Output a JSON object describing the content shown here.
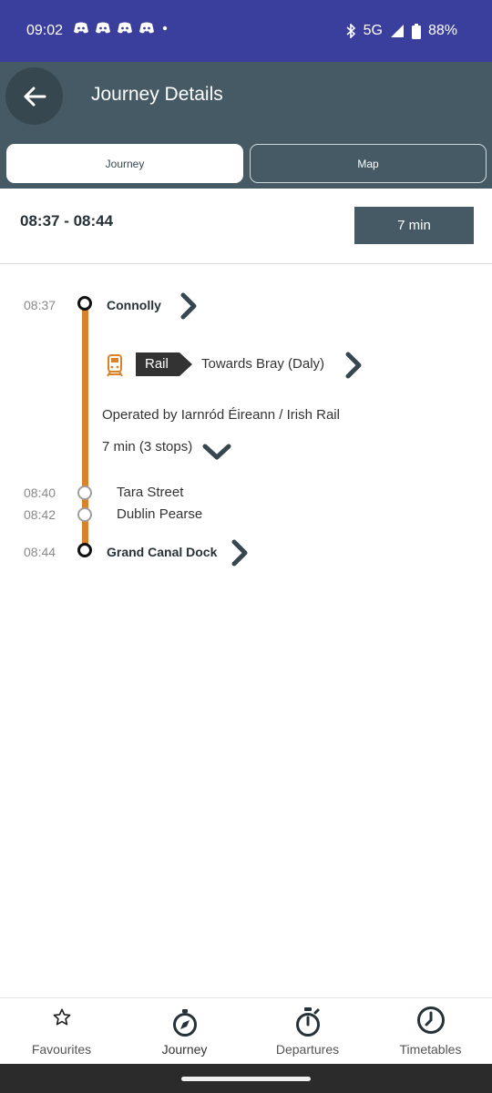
{
  "status_bar": {
    "time": "09:02",
    "network": "5G",
    "battery": "88%",
    "notification_icons": [
      "discord-icon",
      "discord-icon",
      "discord-icon",
      "discord-icon",
      "dot-icon"
    ]
  },
  "app_bar": {
    "title": "Journey Details"
  },
  "tabs": [
    {
      "label": "Journey",
      "selected": true
    },
    {
      "label": "Map",
      "selected": false
    }
  ],
  "summary": {
    "time_range": "08:37 - 08:44",
    "duration": "7 min"
  },
  "journey": {
    "origin": {
      "time": "08:37",
      "name": "Connolly"
    },
    "leg": {
      "mode": "Rail",
      "direction": "Towards Bray (Daly)",
      "operator": "Operated by Iarnród Éireann / Irish Rail",
      "stops_summary": "7 min (3 stops)"
    },
    "intermediate_stops": [
      {
        "time": "08:40",
        "name": "Tara Street"
      },
      {
        "time": "08:42",
        "name": "Dublin Pearse"
      }
    ],
    "destination": {
      "time": "08:44",
      "name": "Grand Canal Dock"
    }
  },
  "bottom_nav": [
    {
      "label": "Favourites",
      "icon": "star-icon"
    },
    {
      "label": "Journey",
      "icon": "compass-icon",
      "active": true
    },
    {
      "label": "Departures",
      "icon": "stopwatch-icon"
    },
    {
      "label": "Timetables",
      "icon": "clock-icon"
    }
  ],
  "colors": {
    "status_bar": "#3a3f9e",
    "app_bar": "#455a64",
    "route_line": "#d9822b",
    "rail_badge": "#333333"
  }
}
